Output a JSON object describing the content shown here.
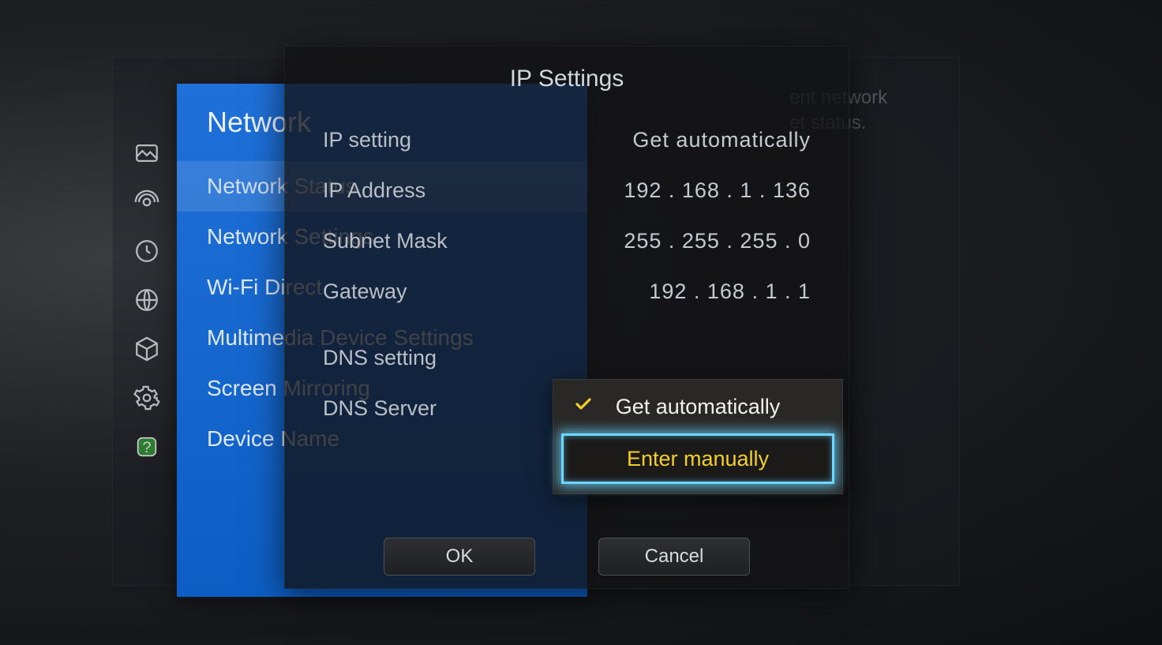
{
  "background_panel": {
    "title": "Network",
    "items": [
      "Network Status",
      "Network Settings",
      "Wi-Fi Direct",
      "Multimedia Device Settings",
      "Screen Mirroring",
      "Device Name"
    ],
    "selected_index": 0
  },
  "help_text": {
    "line1": "ent network",
    "line2": "et status."
  },
  "side_icons": [
    "picture-icon",
    "broadcast-icon",
    "clock-icon",
    "globe-icon",
    "cube-icon",
    "gear-icon",
    "help-icon"
  ],
  "dialog": {
    "title": "IP Settings",
    "rows": [
      {
        "label": "IP setting",
        "value": "Get automatically"
      },
      {
        "label": "IP Address",
        "value": "192 . 168 . 1 . 136"
      },
      {
        "label": "Subnet Mask",
        "value": "255 . 255 . 255 . 0"
      },
      {
        "label": "Gateway",
        "value": "192 . 168 . 1 . 1"
      }
    ],
    "dns_setting_label": "DNS setting",
    "dns_server_label": "DNS Server",
    "dropdown": {
      "options": [
        "Get automatically",
        "Enter manually"
      ],
      "checked_index": 0,
      "focused_index": 1
    },
    "buttons": {
      "ok": "OK",
      "cancel": "Cancel"
    }
  }
}
